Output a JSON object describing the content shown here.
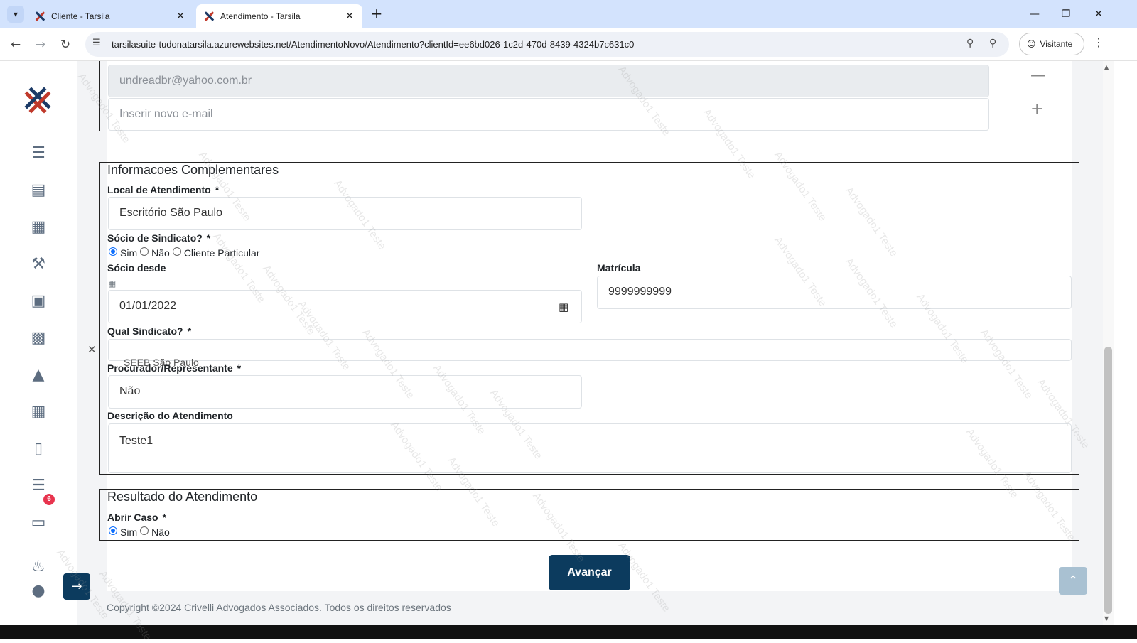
{
  "browser": {
    "tabs": [
      {
        "title": "Cliente - Tarsila"
      },
      {
        "title": "Atendimento - Tarsila"
      }
    ],
    "url": "tarsilasuite-tudonatarsila.azurewebsites.net/AtendimentoNovo/Atendimento?clientId=ee6bd026-1c2d-470d-8439-4324b7c631c0",
    "profile_label": "Visitante"
  },
  "sidebar": {
    "notification_count": "6"
  },
  "email": {
    "existing": "undreadbr@yahoo.com.br",
    "new_placeholder": "Inserir novo e-mail"
  },
  "info": {
    "title": "Informacoes Complementares",
    "local_label": "Local de Atendimento",
    "local_value": "Escritório São Paulo",
    "socio_label": "Sócio de Sindicato?",
    "socio_options": [
      "Sim",
      "Não",
      "Cliente Particular"
    ],
    "socio_selected": "Sim",
    "socio_desde_label": "Sócio desde",
    "socio_desde_value": "01/01/2022",
    "matricula_label": "Matrícula",
    "matricula_value": "9999999999",
    "sindicato_label": "Qual Sindicato?",
    "sindicato_value": "SEEB São Paulo",
    "procurador_label": "Procurador/Representante",
    "procurador_value": "Não",
    "descricao_label": "Descrição do Atendimento",
    "descricao_value": "Teste1",
    "required_mark": "*"
  },
  "result": {
    "title": "Resultado do Atendimento",
    "abrir_label": "Abrir Caso",
    "abrir_options": [
      "Sim",
      "Não"
    ],
    "abrir_selected": "Sim"
  },
  "actions": {
    "submit_label": "Avançar"
  },
  "footer": {
    "copyright": "Copyright ©2024 Crivelli Advogados Associados. Todos os direitos reservados"
  },
  "watermark_text": "Advogado1 Teste"
}
